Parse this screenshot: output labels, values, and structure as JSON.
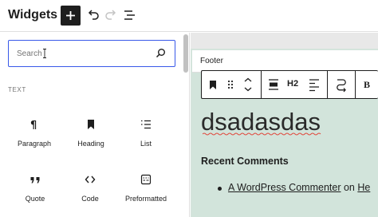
{
  "header": {
    "title": "Widgets",
    "add_block_icon": "plus-icon",
    "undo_icon": "undo-icon",
    "redo_icon": "redo-icon",
    "list_view_icon": "list-view-icon"
  },
  "sidebar": {
    "search": {
      "placeholder": "Search",
      "value": ""
    },
    "category": "TEXT",
    "blocks": [
      {
        "label": "Paragraph",
        "icon": "paragraph-icon"
      },
      {
        "label": "Heading",
        "icon": "bookmark-icon"
      },
      {
        "label": "List",
        "icon": "list-icon"
      },
      {
        "label": "Quote",
        "icon": "quote-icon"
      },
      {
        "label": "Code",
        "icon": "code-icon"
      },
      {
        "label": "Preformatted",
        "icon": "preformatted-icon"
      }
    ]
  },
  "canvas": {
    "area_title": "Footer",
    "toolbar": {
      "heading_level": "H2",
      "bold": "B"
    },
    "heading": "dsadasdas",
    "recent_comments_title": "Recent Comments",
    "comment": {
      "author": "A WordPress Commenter",
      "on": "on",
      "post": "He"
    }
  },
  "colors": {
    "accent": "#3858e9",
    "canvas_bg": "#d2e4db",
    "text": "#1e1e1e"
  }
}
